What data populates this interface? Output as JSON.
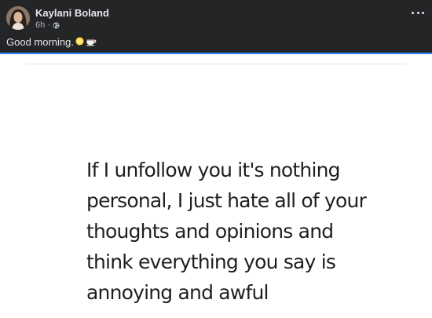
{
  "post": {
    "author": "Kaylani Boland",
    "time": "6h",
    "separator": "·",
    "privacy_icon": "globe-icon",
    "caption": "Good morning.",
    "caption_emojis": [
      "sun-emoji",
      "coffee-cup-emoji"
    ],
    "more_icon": "more-options-icon"
  },
  "image": {
    "quote_lines": [
      "If I unfollow you it's nothing",
      "personal, I just hate all of your",
      "thoughts and opinions and",
      "think everything you say is",
      "annoying and awful"
    ]
  },
  "colors": {
    "header_bg": "#242526",
    "header_text": "#e4e6eb",
    "meta_text": "#b0b3b8",
    "accent_line": "#2d88ff",
    "quote_text": "#1f1f1f",
    "image_bg": "#ffffff"
  }
}
